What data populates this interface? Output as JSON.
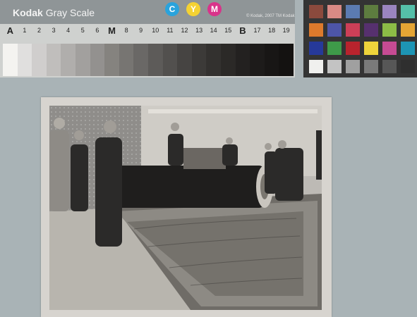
{
  "gray_scale_card": {
    "brand": "Kodak",
    "title": "Gray Scale",
    "copyright": "© Kodak, 2007 TM Kodak",
    "cym_letters": [
      "C",
      "Y",
      "M"
    ],
    "cym_colors": [
      "#2aa3dc",
      "#f4d233",
      "#d9338a"
    ],
    "patch_labels": [
      "A",
      "1",
      "2",
      "3",
      "4",
      "5",
      "6",
      "M",
      "8",
      "9",
      "10",
      "11",
      "12",
      "13",
      "14",
      "15",
      "B",
      "17",
      "18",
      "19"
    ],
    "patch_grays": [
      "#f4f3f0",
      "#e0dfde",
      "#d0cecd",
      "#c0bebc",
      "#b0aeac",
      "#a2a09e",
      "#93918f",
      "#85837f",
      "#777572",
      "#6a6866",
      "#5d5b59",
      "#52504e",
      "#464442",
      "#3c3a38",
      "#33312f",
      "#2b2927",
      "#232120",
      "#1d1b1a",
      "#181615",
      "#141211"
    ]
  },
  "color_card": {
    "patches": [
      "#8b4a3d",
      "#d98a85",
      "#5b7bb1",
      "#5d7c3f",
      "#9b85c0",
      "#55bfa9",
      "#dd7a2c",
      "#4d55a8",
      "#cc3f57",
      "#56306e",
      "#8cbc46",
      "#e5a534",
      "#26399a",
      "#3e9a49",
      "#b8232d",
      "#eed43b",
      "#c64b93",
      "#1d95b5",
      "#f0f0ee",
      "#c3c3c3",
      "#a0a0a0",
      "#7a7a7a",
      "#575757",
      "#2f2f2f"
    ]
  }
}
